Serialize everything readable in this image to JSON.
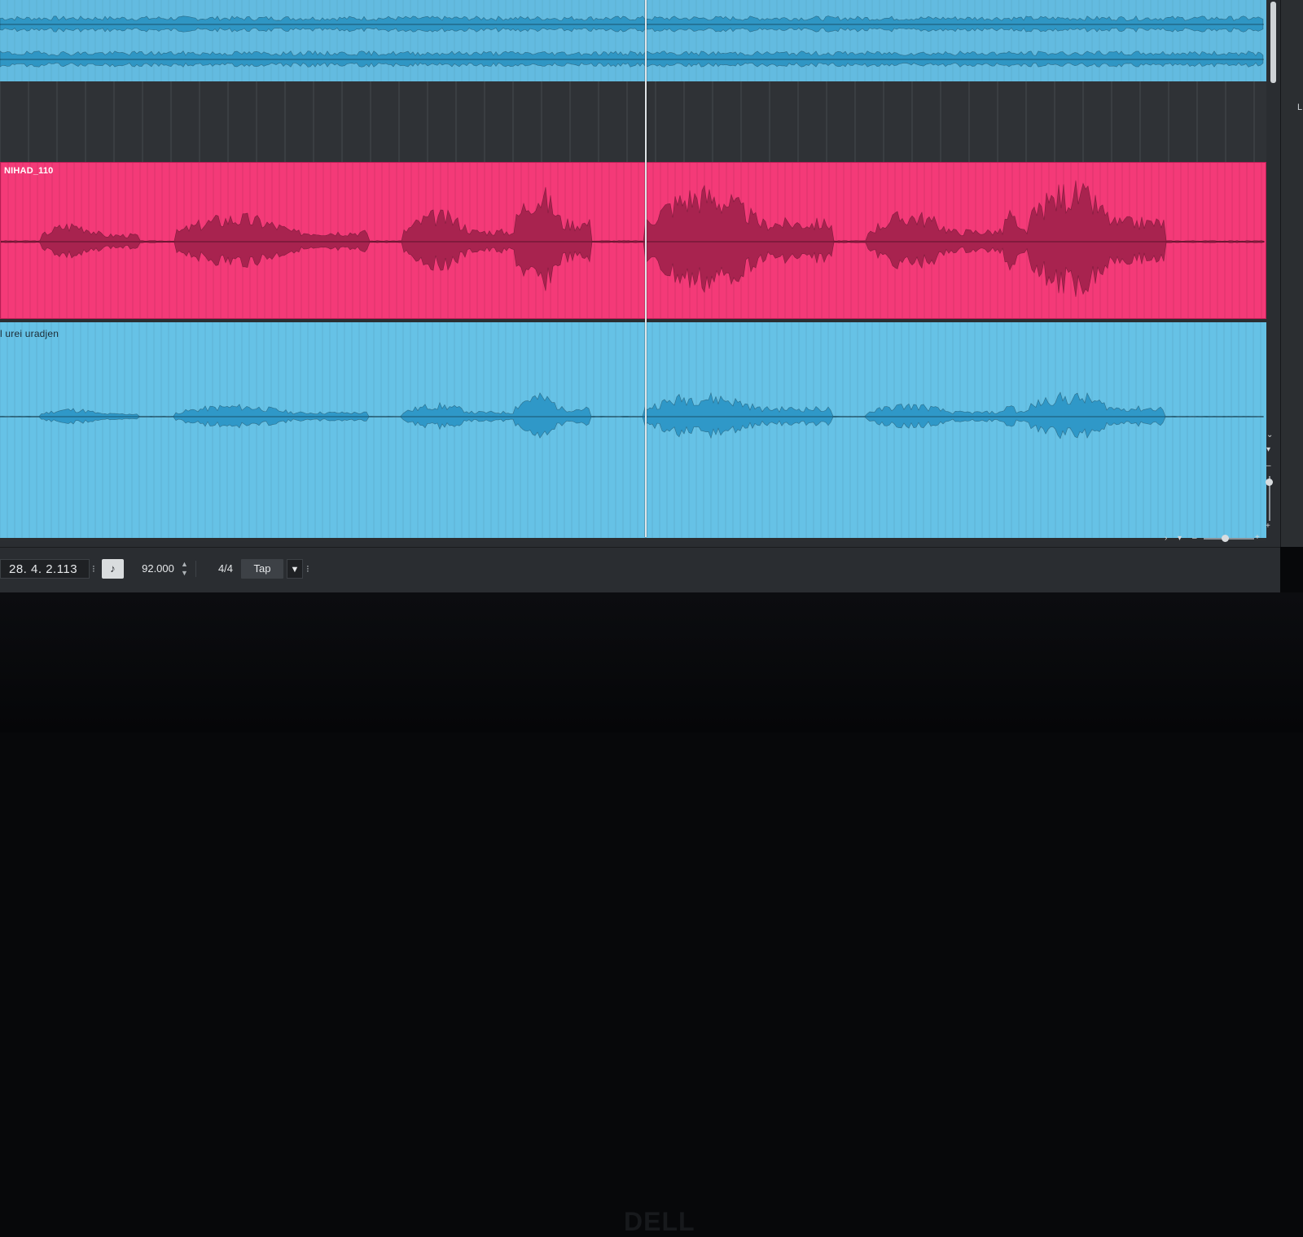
{
  "tracks": {
    "top_clip": {
      "color": "#63bbe0",
      "wave_color": "#2f96c4"
    },
    "pink_clip": {
      "label": "NIHAD_110",
      "color": "#f43a78",
      "wave_color": "#a8234f"
    },
    "bottom_clip": {
      "label": "l urei uradjen",
      "color": "#66c2e6",
      "wave_color": "#2f98c8"
    }
  },
  "transport": {
    "position": "28. 4. 2.113",
    "metronome_icon": "metronome-note-icon",
    "tempo": "92.000",
    "signature": "4/4",
    "tap_label": "Tap",
    "dropdown_glyph": "▼"
  },
  "bezel": {
    "brand": "DELL"
  },
  "right_panel": {
    "letter": "L"
  }
}
